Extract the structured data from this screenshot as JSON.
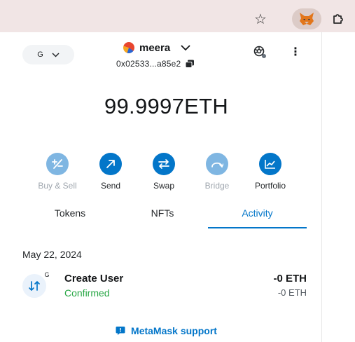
{
  "browser": {
    "bookmark_icon": "star-icon",
    "extension_icon": "metamask-fox-icon",
    "puzzle_icon": "puzzle-icon"
  },
  "header": {
    "network_label": "G",
    "account_name": "meera",
    "address": "0x02533...a85e2"
  },
  "balance": {
    "amount": "99.9997",
    "unit": "ETH"
  },
  "actions": [
    {
      "label": "Buy & Sell",
      "icon": "buy-sell-icon",
      "enabled": false
    },
    {
      "label": "Send",
      "icon": "send-arrow-icon",
      "enabled": true
    },
    {
      "label": "Swap",
      "icon": "swap-arrows-icon",
      "enabled": true
    },
    {
      "label": "Bridge",
      "icon": "bridge-icon",
      "enabled": false
    },
    {
      "label": "Portfolio",
      "icon": "portfolio-chart-icon",
      "enabled": true
    }
  ],
  "tabs": [
    {
      "label": "Tokens",
      "active": false
    },
    {
      "label": "NFTs",
      "active": false
    },
    {
      "label": "Activity",
      "active": true
    }
  ],
  "activity": {
    "date": "May 22, 2024",
    "items": [
      {
        "badge": "G",
        "title": "Create User",
        "status": "Confirmed",
        "amount": "-0 ETH",
        "fiat": "-0 ETH"
      }
    ]
  },
  "support_link": "MetaMask support",
  "colors": {
    "accent": "#0376c9",
    "accent_disabled": "#7fb6e2",
    "success": "#28a745",
    "browser_bar": "#f1e5e5"
  }
}
